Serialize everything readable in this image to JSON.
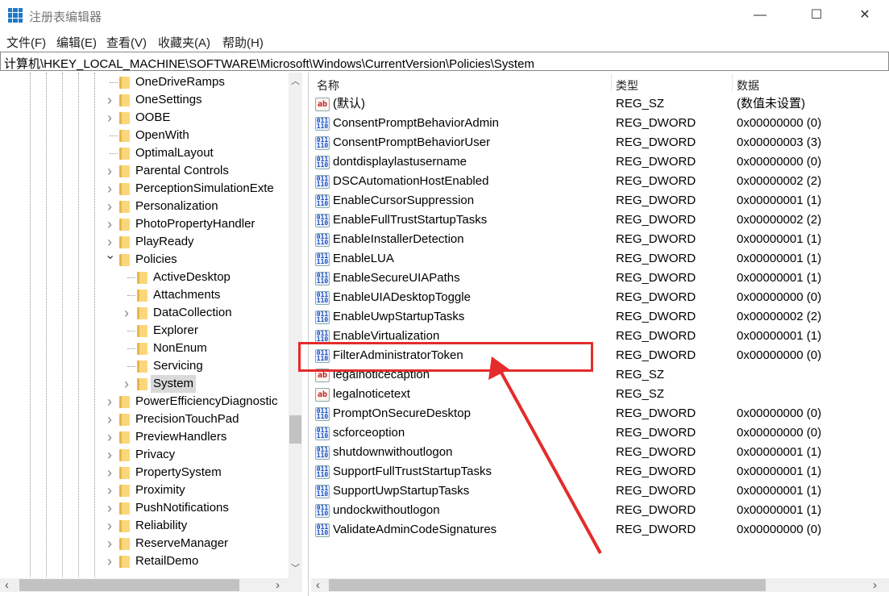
{
  "window": {
    "title": "注册表编辑器",
    "minimize": "—",
    "maximize": "☐",
    "close": "✕"
  },
  "menu": [
    "文件(F)",
    "编辑(E)",
    "查看(V)",
    "收藏夹(A)",
    "帮助(H)"
  ],
  "address": "计算机\\HKEY_LOCAL_MACHINE\\SOFTWARE\\Microsoft\\Windows\\CurrentVersion\\Policies\\System",
  "tree": [
    {
      "label": "OneDriveRamps",
      "level": 1,
      "expander": "none"
    },
    {
      "label": "OneSettings",
      "level": 1,
      "expander": "collapsed"
    },
    {
      "label": "OOBE",
      "level": 1,
      "expander": "collapsed"
    },
    {
      "label": "OpenWith",
      "level": 1,
      "expander": "none"
    },
    {
      "label": "OptimalLayout",
      "level": 1,
      "expander": "none"
    },
    {
      "label": "Parental Controls",
      "level": 1,
      "expander": "collapsed"
    },
    {
      "label": "PerceptionSimulationExte",
      "level": 1,
      "expander": "collapsed"
    },
    {
      "label": "Personalization",
      "level": 1,
      "expander": "collapsed"
    },
    {
      "label": "PhotoPropertyHandler",
      "level": 1,
      "expander": "collapsed"
    },
    {
      "label": "PlayReady",
      "level": 1,
      "expander": "collapsed"
    },
    {
      "label": "Policies",
      "level": 1,
      "expander": "expanded"
    },
    {
      "label": "ActiveDesktop",
      "level": 2,
      "expander": "none"
    },
    {
      "label": "Attachments",
      "level": 2,
      "expander": "none"
    },
    {
      "label": "DataCollection",
      "level": 2,
      "expander": "collapsed"
    },
    {
      "label": "Explorer",
      "level": 2,
      "expander": "none"
    },
    {
      "label": "NonEnum",
      "level": 2,
      "expander": "none"
    },
    {
      "label": "Servicing",
      "level": 2,
      "expander": "none"
    },
    {
      "label": "System",
      "level": 2,
      "expander": "collapsed",
      "selected": true
    },
    {
      "label": "PowerEfficiencyDiagnostic",
      "level": 1,
      "expander": "collapsed"
    },
    {
      "label": "PrecisionTouchPad",
      "level": 1,
      "expander": "collapsed"
    },
    {
      "label": "PreviewHandlers",
      "level": 1,
      "expander": "collapsed"
    },
    {
      "label": "Privacy",
      "level": 1,
      "expander": "collapsed"
    },
    {
      "label": "PropertySystem",
      "level": 1,
      "expander": "collapsed"
    },
    {
      "label": "Proximity",
      "level": 1,
      "expander": "collapsed"
    },
    {
      "label": "PushNotifications",
      "level": 1,
      "expander": "collapsed"
    },
    {
      "label": "Reliability",
      "level": 1,
      "expander": "collapsed"
    },
    {
      "label": "ReserveManager",
      "level": 1,
      "expander": "collapsed"
    },
    {
      "label": "RetailDemo",
      "level": 1,
      "expander": "collapsed"
    }
  ],
  "columns": {
    "name": "名称",
    "type": "类型",
    "data": "数据"
  },
  "values": [
    {
      "name": "(默认)",
      "type": "REG_SZ",
      "data": "(数值未设置)",
      "icon": "string"
    },
    {
      "name": "ConsentPromptBehaviorAdmin",
      "type": "REG_DWORD",
      "data": "0x00000000 (0)",
      "icon": "dword"
    },
    {
      "name": "ConsentPromptBehaviorUser",
      "type": "REG_DWORD",
      "data": "0x00000003 (3)",
      "icon": "dword"
    },
    {
      "name": "dontdisplaylastusername",
      "type": "REG_DWORD",
      "data": "0x00000000 (0)",
      "icon": "dword"
    },
    {
      "name": "DSCAutomationHostEnabled",
      "type": "REG_DWORD",
      "data": "0x00000002 (2)",
      "icon": "dword"
    },
    {
      "name": "EnableCursorSuppression",
      "type": "REG_DWORD",
      "data": "0x00000001 (1)",
      "icon": "dword"
    },
    {
      "name": "EnableFullTrustStartupTasks",
      "type": "REG_DWORD",
      "data": "0x00000002 (2)",
      "icon": "dword"
    },
    {
      "name": "EnableInstallerDetection",
      "type": "REG_DWORD",
      "data": "0x00000001 (1)",
      "icon": "dword"
    },
    {
      "name": "EnableLUA",
      "type": "REG_DWORD",
      "data": "0x00000001 (1)",
      "icon": "dword"
    },
    {
      "name": "EnableSecureUIAPaths",
      "type": "REG_DWORD",
      "data": "0x00000001 (1)",
      "icon": "dword"
    },
    {
      "name": "EnableUIADesktopToggle",
      "type": "REG_DWORD",
      "data": "0x00000000 (0)",
      "icon": "dword"
    },
    {
      "name": "EnableUwpStartupTasks",
      "type": "REG_DWORD",
      "data": "0x00000002 (2)",
      "icon": "dword"
    },
    {
      "name": "EnableVirtualization",
      "type": "REG_DWORD",
      "data": "0x00000001 (1)",
      "icon": "dword"
    },
    {
      "name": "FilterAdministratorToken",
      "type": "REG_DWORD",
      "data": "0x00000000 (0)",
      "icon": "dword",
      "highlighted": true
    },
    {
      "name": "legalnoticecaption",
      "type": "REG_SZ",
      "data": "",
      "icon": "string"
    },
    {
      "name": "legalnoticetext",
      "type": "REG_SZ",
      "data": "",
      "icon": "string"
    },
    {
      "name": "PromptOnSecureDesktop",
      "type": "REG_DWORD",
      "data": "0x00000000 (0)",
      "icon": "dword"
    },
    {
      "name": "scforceoption",
      "type": "REG_DWORD",
      "data": "0x00000000 (0)",
      "icon": "dword"
    },
    {
      "name": "shutdownwithoutlogon",
      "type": "REG_DWORD",
      "data": "0x00000001 (1)",
      "icon": "dword"
    },
    {
      "name": "SupportFullTrustStartupTasks",
      "type": "REG_DWORD",
      "data": "0x00000001 (1)",
      "icon": "dword"
    },
    {
      "name": "SupportUwpStartupTasks",
      "type": "REG_DWORD",
      "data": "0x00000001 (1)",
      "icon": "dword"
    },
    {
      "name": "undockwithoutlogon",
      "type": "REG_DWORD",
      "data": "0x00000001 (1)",
      "icon": "dword"
    },
    {
      "name": "ValidateAdminCodeSignatures",
      "type": "REG_DWORD",
      "data": "0x00000000 (0)",
      "icon": "dword"
    }
  ],
  "annotation_color": "#e52b2b"
}
